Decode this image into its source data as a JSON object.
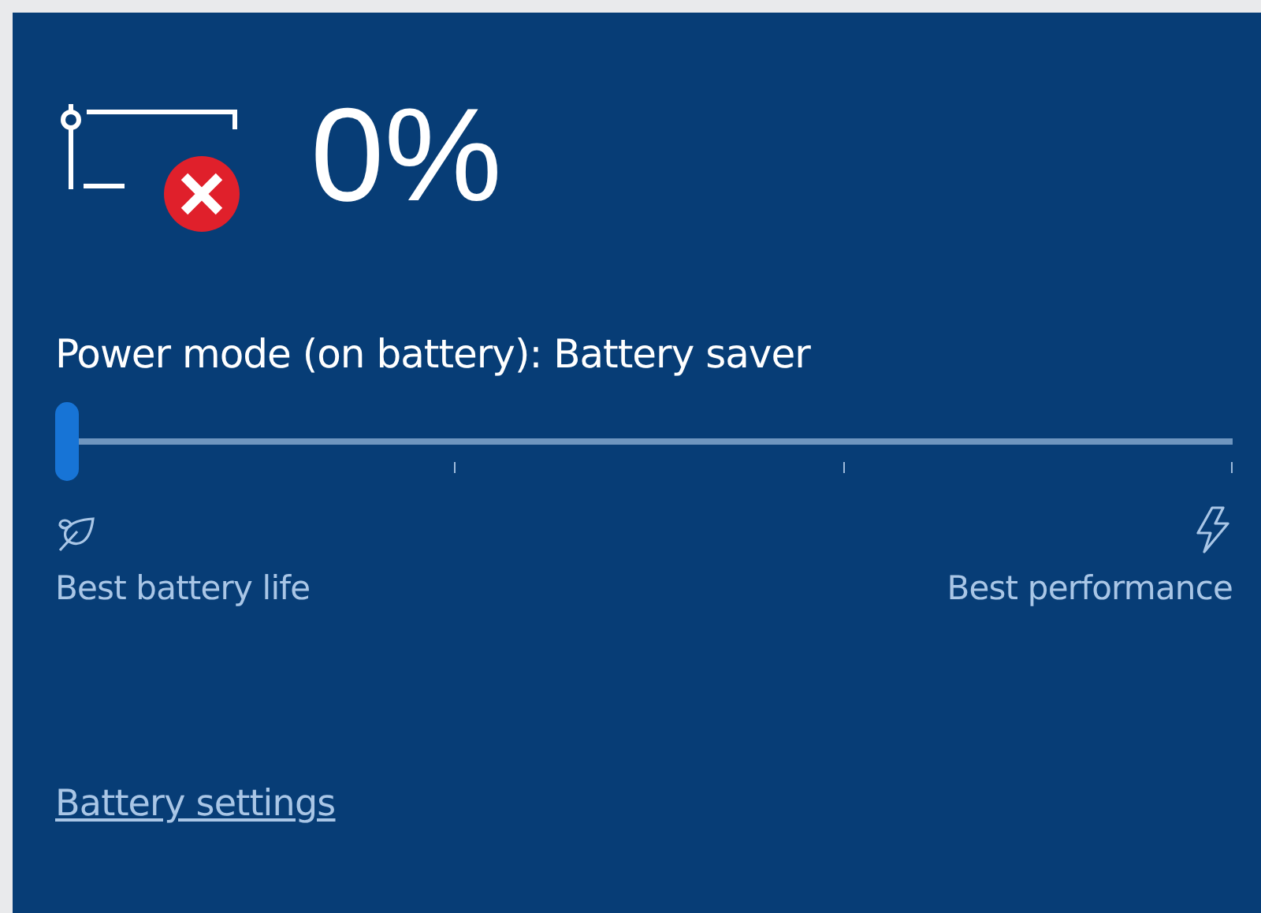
{
  "battery": {
    "percent": "0%",
    "error": true
  },
  "power_mode": {
    "label": "Power mode (on battery): Battery saver",
    "level": 0,
    "min_label": "Best battery life",
    "max_label": "Best performance"
  },
  "link": "Battery settings"
}
